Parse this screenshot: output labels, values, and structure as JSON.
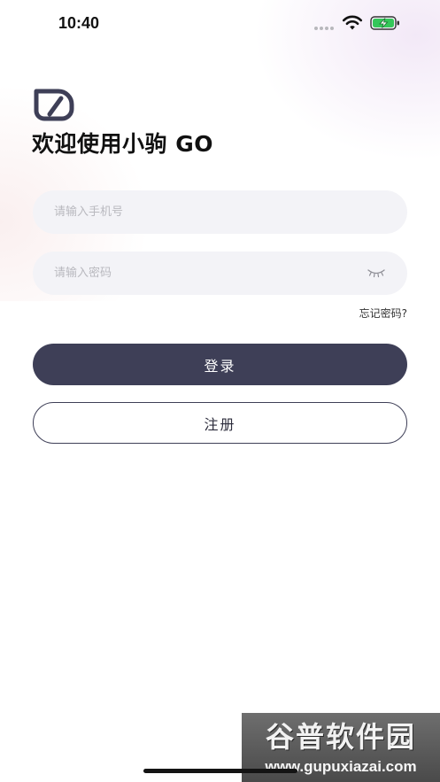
{
  "status_bar": {
    "time": "10:40",
    "icons": [
      "signal-dots-icon",
      "wifi-icon",
      "battery-charging-icon"
    ],
    "battery_color": "#34c759"
  },
  "logo": {
    "icon": "app-logo-icon",
    "color": "#3e3f57"
  },
  "welcome_title": "欢迎使用小驹 GO",
  "login_form": {
    "phone_placeholder": "请输入手机号",
    "password_placeholder": "请输入密码",
    "password_toggle_icon": "eye-closed-icon",
    "forgot_password": "忘记密码?",
    "login_button": "登录",
    "register_button": "注册"
  },
  "colors": {
    "primary": "#3e3f57",
    "field_background": "#f3f3f7",
    "placeholder": "#b9b9bf"
  },
  "watermark": {
    "title": "谷普软件园",
    "url": "www.gupuxiazai.com"
  }
}
